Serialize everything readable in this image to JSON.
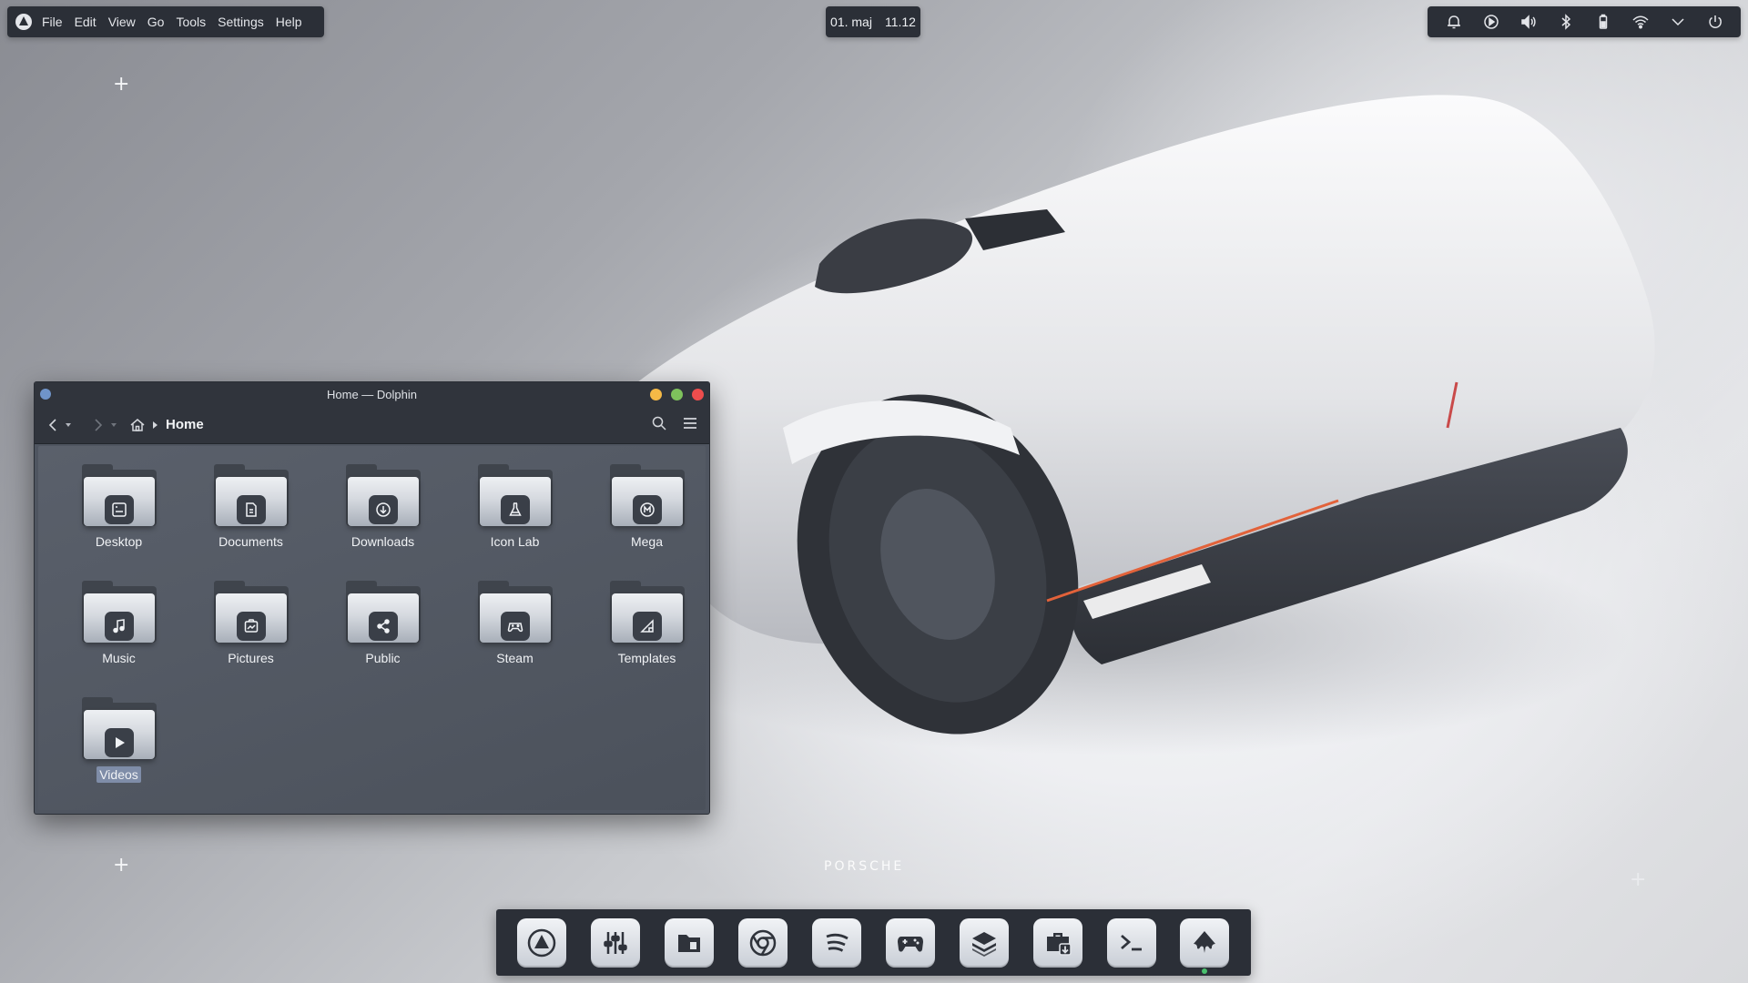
{
  "menubar": {
    "items": [
      "File",
      "Edit",
      "View",
      "Go",
      "Tools",
      "Settings",
      "Help"
    ]
  },
  "clock": {
    "date": "01. maj",
    "time": "11.12"
  },
  "tray": {
    "icons": [
      "alarm-icon",
      "play-icon",
      "volume-icon",
      "bluetooth-icon",
      "battery-icon",
      "wifi-icon",
      "chevron-down-icon",
      "power-icon"
    ]
  },
  "wallpaper": {
    "brand": "PORSCHE"
  },
  "window": {
    "title": "Home — Dolphin",
    "breadcrumb": "Home",
    "folders": [
      {
        "label": "Desktop",
        "icon": "desktop-icon"
      },
      {
        "label": "Documents",
        "icon": "document-icon"
      },
      {
        "label": "Downloads",
        "icon": "download-icon"
      },
      {
        "label": "Icon Lab",
        "icon": "flask-icon"
      },
      {
        "label": "Mega",
        "icon": "mega-icon"
      },
      {
        "label": "Music",
        "icon": "music-note-icon"
      },
      {
        "label": "Pictures",
        "icon": "picture-icon"
      },
      {
        "label": "Public",
        "icon": "share-icon"
      },
      {
        "label": "Steam",
        "icon": "gamepad-icon"
      },
      {
        "label": "Templates",
        "icon": "template-icon"
      },
      {
        "label": "Videos",
        "icon": "play-icon",
        "selected": true
      }
    ]
  },
  "dock": {
    "apps": [
      "system-logo-icon",
      "mixer-icon",
      "file-manager-icon",
      "chrome-icon",
      "spotify-icon",
      "gamepad-icon",
      "layers-icon",
      "package-install-icon",
      "terminal-icon",
      "inkscape-icon"
    ]
  },
  "colors": {
    "panel": "#2b2f37",
    "window_bg": "#4f5560",
    "selection": "#7f8da8",
    "close": "#ee4d4d",
    "minimize": "#f5b946",
    "maximize": "#7ec25c"
  }
}
